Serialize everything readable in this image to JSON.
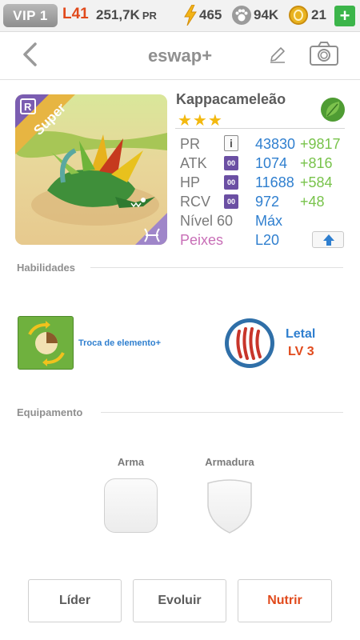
{
  "status_bar": {
    "vip": "VIP 1",
    "level": "L41",
    "pr_value": "251,7K",
    "pr_unit": "PR",
    "energy": "465",
    "food": "94K",
    "coins": "21",
    "add_label": "+",
    "icons": [
      "energy-bolt-icon",
      "food-paw-icon",
      "coin-icon"
    ]
  },
  "header": {
    "title": "eswap+",
    "icons": [
      "back-chevron-icon",
      "edit-pencil-icon",
      "camera-icon"
    ]
  },
  "creature": {
    "name": "Kappacameleão",
    "rarity_letter": "R",
    "ribbon": "Super",
    "stars": "★★★",
    "element_icon": "leaf-icon",
    "stats": [
      {
        "label": "PR",
        "badge": "i",
        "value": "43830",
        "bonus": "+9817"
      },
      {
        "label": "ATK",
        "badge": "00",
        "value": "1074",
        "bonus": "+816"
      },
      {
        "label": "HP",
        "badge": "00",
        "value": "11688",
        "bonus": "+584"
      },
      {
        "label": "RCV",
        "badge": "00",
        "value": "972",
        "bonus": "+48"
      }
    ],
    "level_label": "Nível 60",
    "level_value": "Máx",
    "element_label": "Peixes",
    "element_value": "L20"
  },
  "skills": {
    "section_title": "Habilidades",
    "active_name": "Troca de elemento+",
    "passive_name": "Letal",
    "passive_level": "LV 3"
  },
  "equipment": {
    "section_title": "Equipamento",
    "weapon_label": "Arma",
    "armor_label": "Armadura"
  },
  "actions": {
    "leader": "Líder",
    "evolve": "Evoluir",
    "feed": "Nutrir"
  },
  "colors": {
    "accent_blue": "#2f7fcf",
    "bonus_green": "#78c34b",
    "orange": "#e14a1c",
    "star_gold": "#f3b90f",
    "element_pink": "#c86fb7"
  }
}
